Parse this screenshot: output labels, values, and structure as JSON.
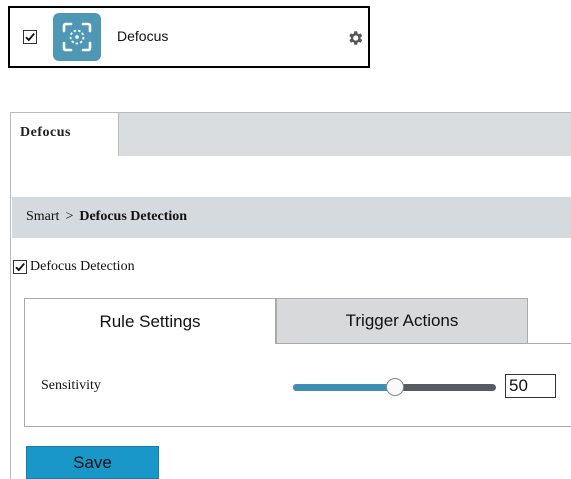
{
  "function_card": {
    "enabled": true,
    "label": "Defocus",
    "icon": "defocus-icon",
    "settings_icon": "gear-icon",
    "icon_color": "#4f98b5"
  },
  "panel": {
    "tab_label": "Defocus",
    "breadcrumb": {
      "parent": "Smart",
      "separator": ">",
      "current": "Defocus Detection"
    },
    "enable_checkbox": {
      "checked": true,
      "label": "Defocus Detection"
    },
    "subtabs": [
      {
        "label": "Rule Settings",
        "active": true
      },
      {
        "label": "Trigger Actions",
        "active": false
      }
    ],
    "sensitivity": {
      "label": "Sensitivity",
      "value": "50",
      "min": 0,
      "max": 100
    },
    "save_label": "Save",
    "accent_color": "#1a97c9"
  }
}
